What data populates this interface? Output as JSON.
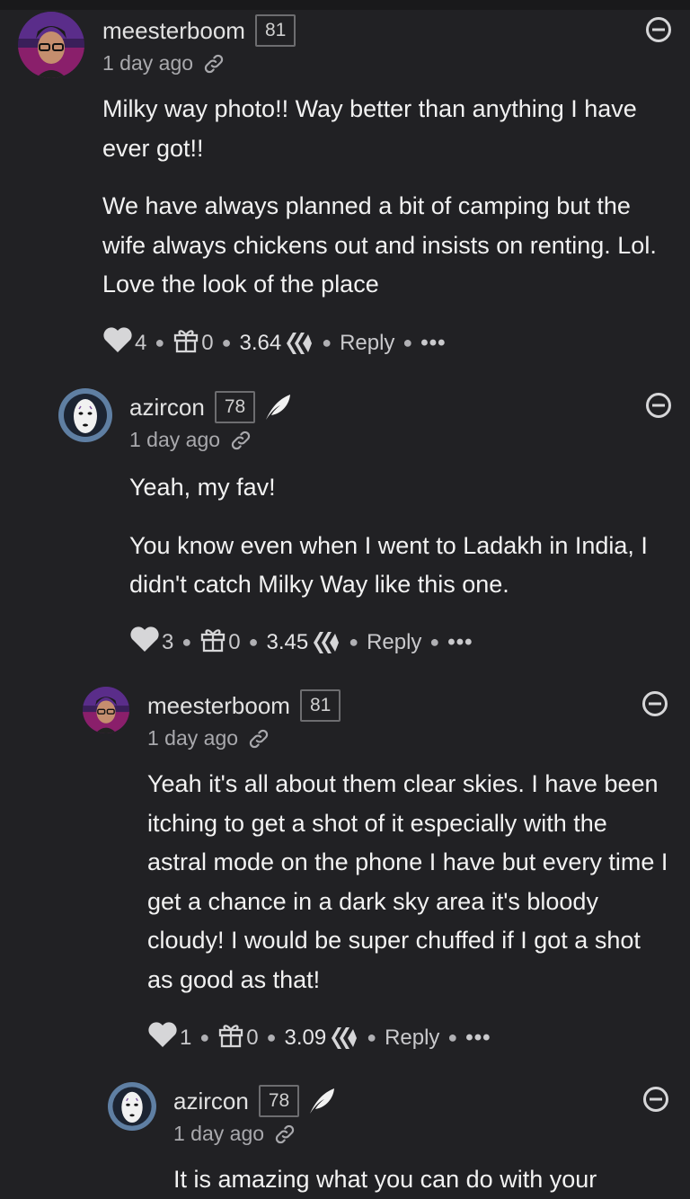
{
  "comments": [
    {
      "username": "meesterboom",
      "reputation": "81",
      "time": "1 day ago",
      "paragraphs": [
        "Milky way photo!! Way better than anything I have ever got!!",
        "We have always planned a bit of camping but the wife always chickens out and insists on renting. Lol. Love the look of the place"
      ],
      "votes": "4",
      "gifts": "0",
      "payout": "3.64",
      "reply_label": "Reply",
      "more_label": "•••"
    },
    {
      "username": "azircon",
      "reputation": "78",
      "time": "1 day ago",
      "paragraphs": [
        "Yeah, my fav!",
        "You know even when I went to Ladakh in India, I didn't catch Milky Way like this one."
      ],
      "votes": "3",
      "gifts": "0",
      "payout": "3.45",
      "reply_label": "Reply",
      "more_label": "•••"
    },
    {
      "username": "meesterboom",
      "reputation": "81",
      "time": "1 day ago",
      "paragraphs": [
        "Yeah it's all about them clear skies. I have been itching to get a shot of it especially with the astral mode on the phone I have but every time I get a chance in a dark sky area it's bloody cloudy! I would be super chuffed if I got a shot as good as that!"
      ],
      "votes": "1",
      "gifts": "0",
      "payout": "3.09",
      "reply_label": "Reply",
      "more_label": "•••"
    },
    {
      "username": "azircon",
      "reputation": "78",
      "time": "1 day ago",
      "paragraphs": [
        "It is amazing what you can do with your"
      ]
    }
  ],
  "icons": {
    "collapse": "minus-circle-icon",
    "link": "link-icon",
    "vote": "heart-icon",
    "gift": "gift-icon",
    "hive": "hive-logo-icon",
    "badge": "feather-icon"
  },
  "colors": {
    "background": "#212124",
    "text": "#f2f2f2",
    "muted": "#a9a9ad"
  }
}
